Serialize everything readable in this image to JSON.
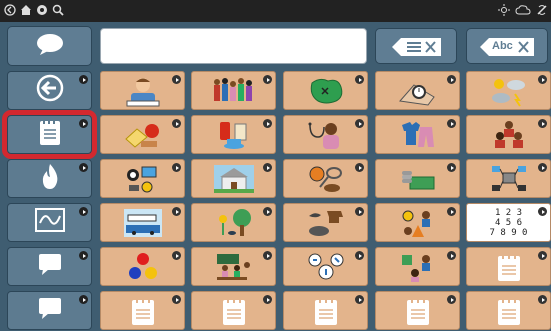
{
  "colors": {
    "panel": "#3f5d71",
    "button": "#5f7d93",
    "tile": "#e3b48c",
    "selection": "#d3282f"
  },
  "topbar": {
    "left_icons": [
      "back-circle-icon",
      "home-icon",
      "settings-gear-icon",
      "search-icon"
    ],
    "right_icons": [
      "brightness-icon",
      "cloud-sync-icon",
      "no-sync-icon"
    ]
  },
  "toolbar": {
    "speak_icon": "speech-bubble-icon",
    "message_value": "",
    "clear_word_icon": "delete-word-icon",
    "clear_all_label": "Abc"
  },
  "sidebar": [
    {
      "icon": "back-arrow-icon",
      "selected": false
    },
    {
      "icon": "notepad-icon",
      "selected": true
    },
    {
      "icon": "flame-icon",
      "selected": false
    },
    {
      "icon": "waveform-icon",
      "selected": false
    },
    {
      "icon": "speech-bubble-icon",
      "selected": false
    },
    {
      "icon": "speech-bubble-icon",
      "selected": false
    }
  ],
  "grid": {
    "rows": [
      [
        "person-icon",
        "family-icon",
        "map-icon",
        "watch-icon",
        "weather-icon"
      ],
      [
        "food-icon",
        "drinks-icon",
        "doctor-icon",
        "clothes-icon",
        "people-icon"
      ],
      [
        "toys-icon",
        "house-icon",
        "sports-icon",
        "money-icon",
        "technology-icon"
      ],
      [
        "transport-icon",
        "nature-icon",
        "animals-icon",
        "activities-icon",
        "numbers-icon"
      ],
      [
        "colors-icon",
        "school-icon",
        "actions-icon",
        "feelings-icon",
        "notepad-icon"
      ],
      [
        "notepad-icon",
        "notepad-icon",
        "notepad-icon",
        "notepad-icon",
        "notepad-icon"
      ]
    ],
    "numbers_text": "1 2 3\n4 5 6\n7 8 9 0"
  }
}
